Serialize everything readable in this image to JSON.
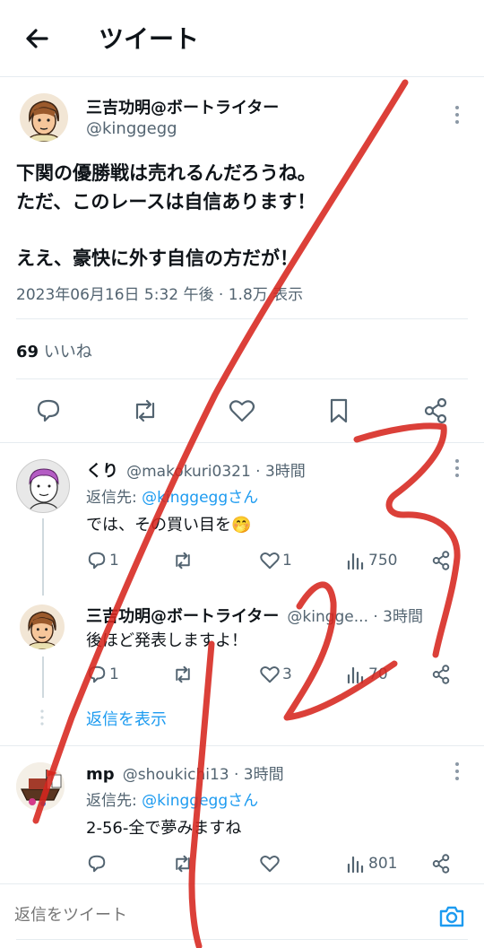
{
  "header": {
    "title": "ツイート"
  },
  "tweet": {
    "author_name": "三吉功明@ボートライター",
    "author_handle": "@kinggegg",
    "text_line1": "下関の優勝戦は売れるんだろうね。",
    "text_line2": "ただ、このレースは自信あります！",
    "text_line3": "ええ、豪快に外す自信の方だが！",
    "meta": "2023年06月16日 5:32 午後 · 1.8万 表示",
    "likes_count": "69",
    "likes_label": "いいね"
  },
  "replies": [
    {
      "name": "くり",
      "handle_time": "@makokuri0321 · 3時間",
      "reply_to_prefix": "返信先: ",
      "reply_to_user": "@kinggeggさん",
      "text": "では、その買い目を🤭",
      "reply_count": "1",
      "retweet_count": "",
      "like_count": "1",
      "view_count": "750"
    },
    {
      "name": "三吉功明@ボートライター",
      "handle_time": "@kingge... · 3時間",
      "text": "後ほど発表しますよ！",
      "reply_count": "1",
      "retweet_count": "",
      "like_count": "3",
      "view_count": "70"
    },
    {
      "name": "mp",
      "handle_time": "@shoukichi13 · 3時間",
      "reply_to_prefix": "返信先: ",
      "reply_to_user": "@kinggeggさん",
      "text": "2-56-全で夢みますね",
      "reply_count": "",
      "retweet_count": "",
      "like_count": "",
      "view_count": "801"
    }
  ],
  "show_replies": "返信を表示",
  "compose": {
    "placeholder": "返信をツイート"
  },
  "colors": {
    "accent": "#1d9bf0",
    "annotation": "#d7261e"
  },
  "annotation_icon": "red-handwritten-123-and-slash",
  "avatar_icons": [
    "cartoon-man-avatar",
    "purple-hair-sketch-avatar",
    "boat-flag-avatar"
  ]
}
